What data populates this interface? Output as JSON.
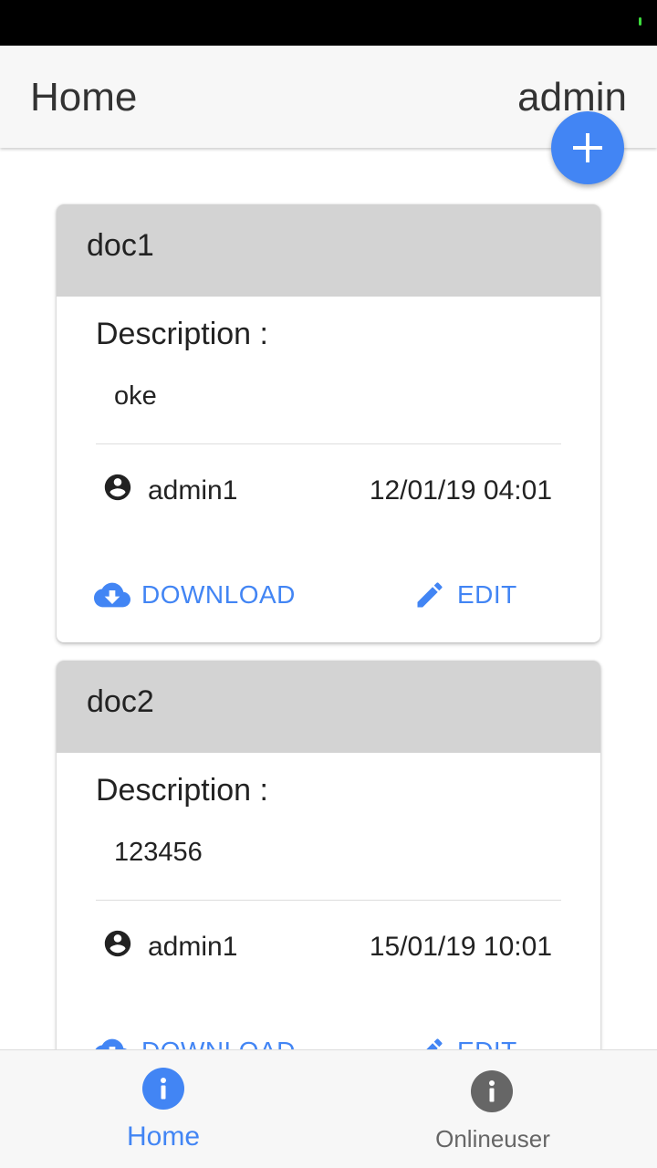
{
  "header": {
    "title": "Home",
    "user": "admin"
  },
  "fab": {
    "icon": "plus-icon"
  },
  "documents": [
    {
      "title": "doc1",
      "description_label": "Description :",
      "description": "oke",
      "author": "admin1",
      "date": "12/01/19 04:01",
      "download_label": "DOWNLOAD",
      "edit_label": "EDIT"
    },
    {
      "title": "doc2",
      "description_label": "Description :",
      "description": "123456",
      "author": "admin1",
      "date": "15/01/19 10:01",
      "download_label": "DOWNLOAD",
      "edit_label": "EDIT"
    }
  ],
  "bottom_nav": [
    {
      "label": "Home",
      "icon": "info-icon",
      "active": true
    },
    {
      "label": "Onlineuser",
      "icon": "info-icon",
      "active": false
    }
  ],
  "colors": {
    "accent": "#4285f4",
    "card_header": "#d3d3d3",
    "inactive": "#666666"
  }
}
